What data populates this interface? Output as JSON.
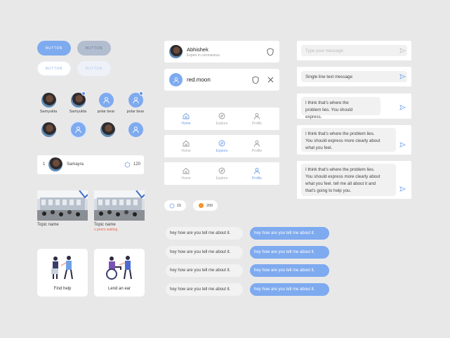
{
  "buttons": {
    "primary": "BUTTON",
    "secondary": "BUTTON",
    "outline": "BUTTON",
    "ghost": "BUTTON"
  },
  "avatars": [
    {
      "label": "Samyukta"
    },
    {
      "label": "Samyukta"
    },
    {
      "label": "polar bear"
    },
    {
      "label": "polar bear"
    }
  ],
  "leaderboard": {
    "rank": "1",
    "name": "Samayra",
    "score": "120"
  },
  "topics": [
    {
      "name": "Topic name",
      "meta": ""
    },
    {
      "name": "Topic name",
      "meta": "x peers waiting"
    }
  ],
  "actions": [
    {
      "label": "Find help"
    },
    {
      "label": "Lend an ear"
    }
  ],
  "profile": {
    "name": "Abhishek",
    "subtitle": "Expert in coronavirus"
  },
  "user": {
    "name": "red.moon"
  },
  "tabs": [
    {
      "home": "Home",
      "explore": "Explore",
      "profile": "Profile",
      "active": "home"
    },
    {
      "home": "Home",
      "explore": "Explore",
      "profile": "Profile",
      "active": "explore"
    },
    {
      "home": "Home",
      "explore": "Explore",
      "profile": "Profile",
      "active": "profile"
    }
  ],
  "chips": [
    {
      "value": "15"
    },
    {
      "value": "200"
    }
  ],
  "chat": {
    "incoming": [
      "hey how are you tell me about it.",
      "hey how are you tell me about it.",
      "hey how are you tell me about it.",
      "hey how are you tell me about it."
    ],
    "outgoing": [
      "hey how are you tell me about it.",
      "hey how are you tell me about it.",
      "hey how are you tell me about it.",
      "hey how are you tell me about it."
    ]
  },
  "inputs": {
    "placeholder": "Type your message",
    "single": "Single line text message",
    "two_line": "I think that's where the problem lies. You should express.",
    "three_line": "I think that's where the problem lies. You should express more clearly about what you feel.",
    "four_line": "I think that's where the problem lies. You should express more clearly about what you feel. tell me all about it and that's going to help you."
  },
  "colors": {
    "accent": "#7eaaef",
    "background": "#e9e8e9"
  }
}
